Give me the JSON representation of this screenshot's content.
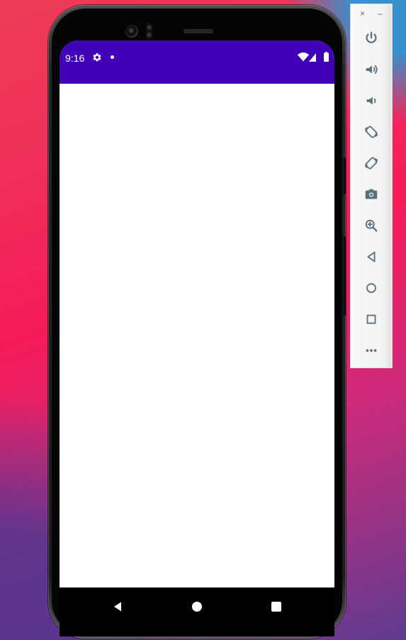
{
  "device": {
    "status_bar": {
      "time": "9:16",
      "icons": [
        "settings-gear-icon",
        "notification-dot-icon",
        "wifi-icon",
        "cellular-signal-icon",
        "battery-icon"
      ],
      "background_color": "#4200b7",
      "text_color": "#ffffff"
    },
    "screen": {
      "background_color": "#ffffff"
    },
    "navigation_bar": {
      "background_color": "#000000",
      "buttons": [
        {
          "name": "back",
          "icon": "back-triangle-icon"
        },
        {
          "name": "home",
          "icon": "home-circle-icon"
        },
        {
          "name": "recents",
          "icon": "recents-square-icon"
        }
      ]
    }
  },
  "emulator_toolbar": {
    "window_controls": {
      "close_label": "×",
      "minimize_label": "–"
    },
    "buttons": [
      {
        "name": "power",
        "icon": "power-icon"
      },
      {
        "name": "volume-up",
        "icon": "volume-up-icon"
      },
      {
        "name": "volume-down",
        "icon": "volume-down-icon"
      },
      {
        "name": "rotate-left",
        "icon": "rotate-left-icon"
      },
      {
        "name": "rotate-right",
        "icon": "rotate-right-icon"
      },
      {
        "name": "screenshot",
        "icon": "camera-icon"
      },
      {
        "name": "zoom",
        "icon": "zoom-in-icon"
      },
      {
        "name": "back",
        "icon": "back-icon"
      },
      {
        "name": "home",
        "icon": "home-icon"
      },
      {
        "name": "overview",
        "icon": "overview-icon"
      },
      {
        "name": "more",
        "icon": "more-icon"
      }
    ],
    "icon_color": "#58717c"
  },
  "colors": {
    "desktop_accent_pink": "#f61b58",
    "desktop_accent_blue": "#2e95d3",
    "desktop_accent_purple": "#5f3c8f"
  }
}
